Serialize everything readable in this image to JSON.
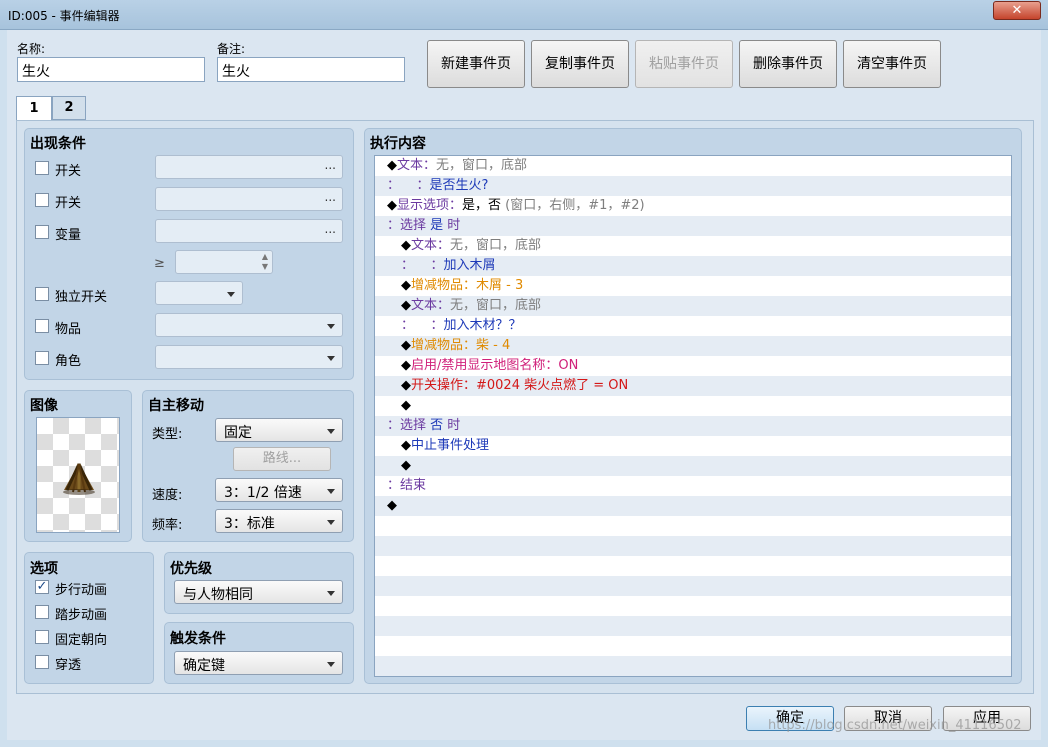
{
  "window": {
    "title": "ID:005 - 事件编辑器",
    "close_symbol": "✕"
  },
  "header": {
    "name_label": "名称:",
    "name_value": "生火",
    "note_label": "备注:",
    "note_value": "生火",
    "buttons": {
      "new_page": "新建事件页",
      "copy_page": "复制事件页",
      "paste_page": "粘贴事件页",
      "delete_page": "删除事件页",
      "clear_page": "清空事件页"
    }
  },
  "tabs": [
    "1",
    "2"
  ],
  "conditions": {
    "title": "出现条件",
    "switch1": "开关",
    "switch2": "开关",
    "variable": "变量",
    "gte": "≥",
    "self_switch": "独立开关",
    "item": "物品",
    "actor": "角色",
    "dots": "..."
  },
  "image": {
    "title": "图像"
  },
  "autonomous": {
    "title": "自主移动",
    "type_label": "类型:",
    "type_value": "固定",
    "route_button": "路线...",
    "speed_label": "速度:",
    "speed_value": "3：1/2 倍速",
    "freq_label": "频率:",
    "freq_value": "3：标准"
  },
  "options": {
    "title": "选项",
    "walking": "步行动画",
    "stepping": "踏步动画",
    "direction_fix": "固定朝向",
    "through": "穿透",
    "walking_checked": true
  },
  "priority": {
    "title": "优先级",
    "value": "与人物相同"
  },
  "trigger": {
    "title": "触发条件",
    "value": "确定键"
  },
  "contents": {
    "title": "执行内容",
    "rows": [
      {
        "indent": "",
        "parts": [
          {
            "t": "◆",
            "c": "c-black"
          },
          {
            "t": "文本：",
            "c": "c-purple"
          },
          {
            "t": "无，窗口，底部",
            "c": "c-gray"
          }
        ]
      },
      {
        "indent": "",
        "parts": [
          {
            "t": "：    ：",
            "c": "c-purple"
          },
          {
            "t": "是否生火?",
            "c": "c-blue"
          }
        ]
      },
      {
        "indent": "",
        "parts": [
          {
            "t": "◆",
            "c": "c-black"
          },
          {
            "t": "显示选项：",
            "c": "c-purple"
          },
          {
            "t": "是，否 ",
            "c": "c-black"
          },
          {
            "t": "(窗口，右侧，#1，#2)",
            "c": "c-gray"
          }
        ]
      },
      {
        "indent": "",
        "parts": [
          {
            "t": "：选择 ",
            "c": "c-purple"
          },
          {
            "t": "是 ",
            "c": "c-blue"
          },
          {
            "t": "时",
            "c": "c-purple"
          }
        ]
      },
      {
        "indent": "  ",
        "parts": [
          {
            "t": "◆",
            "c": "c-black"
          },
          {
            "t": "文本：",
            "c": "c-purple"
          },
          {
            "t": "无，窗口，底部",
            "c": "c-gray"
          }
        ]
      },
      {
        "indent": "  ",
        "parts": [
          {
            "t": "：    ：",
            "c": "c-purple"
          },
          {
            "t": "加入木屑",
            "c": "c-blue"
          }
        ]
      },
      {
        "indent": "  ",
        "parts": [
          {
            "t": "◆",
            "c": "c-black"
          },
          {
            "t": "增减物品：木屑 - 3",
            "c": "c-orange"
          }
        ]
      },
      {
        "indent": "  ",
        "parts": [
          {
            "t": "◆",
            "c": "c-black"
          },
          {
            "t": "文本：",
            "c": "c-purple"
          },
          {
            "t": "无，窗口，底部",
            "c": "c-gray"
          }
        ]
      },
      {
        "indent": "  ",
        "parts": [
          {
            "t": "：    ：",
            "c": "c-purple"
          },
          {
            "t": "加入木材？？",
            "c": "c-blue"
          }
        ]
      },
      {
        "indent": "  ",
        "parts": [
          {
            "t": "◆",
            "c": "c-black"
          },
          {
            "t": "增减物品：柴 - 4",
            "c": "c-orange"
          }
        ]
      },
      {
        "indent": "  ",
        "parts": [
          {
            "t": "◆",
            "c": "c-black"
          },
          {
            "t": "启用/禁用显示地图名称：ON",
            "c": "c-magenta"
          }
        ]
      },
      {
        "indent": "  ",
        "parts": [
          {
            "t": "◆",
            "c": "c-black"
          },
          {
            "t": "开关操作：#0024 柴火点燃了 = ON",
            "c": "c-red"
          }
        ]
      },
      {
        "indent": "  ",
        "parts": [
          {
            "t": "◆",
            "c": "c-black"
          }
        ]
      },
      {
        "indent": "",
        "parts": [
          {
            "t": "：选择 ",
            "c": "c-purple"
          },
          {
            "t": "否 ",
            "c": "c-blue"
          },
          {
            "t": "时",
            "c": "c-purple"
          }
        ]
      },
      {
        "indent": "  ",
        "parts": [
          {
            "t": "◆",
            "c": "c-black"
          },
          {
            "t": "中止事件处理",
            "c": "c-blue"
          }
        ]
      },
      {
        "indent": "  ",
        "parts": [
          {
            "t": "◆",
            "c": "c-black"
          }
        ]
      },
      {
        "indent": "",
        "parts": [
          {
            "t": "：结束",
            "c": "c-purple"
          }
        ]
      },
      {
        "indent": "",
        "parts": [
          {
            "t": "◆",
            "c": "c-black"
          }
        ]
      }
    ]
  },
  "footer": {
    "ok": "确定",
    "cancel": "取消",
    "apply": "应用"
  },
  "watermark": "https://blog.csdn.net/weixin_41116502"
}
